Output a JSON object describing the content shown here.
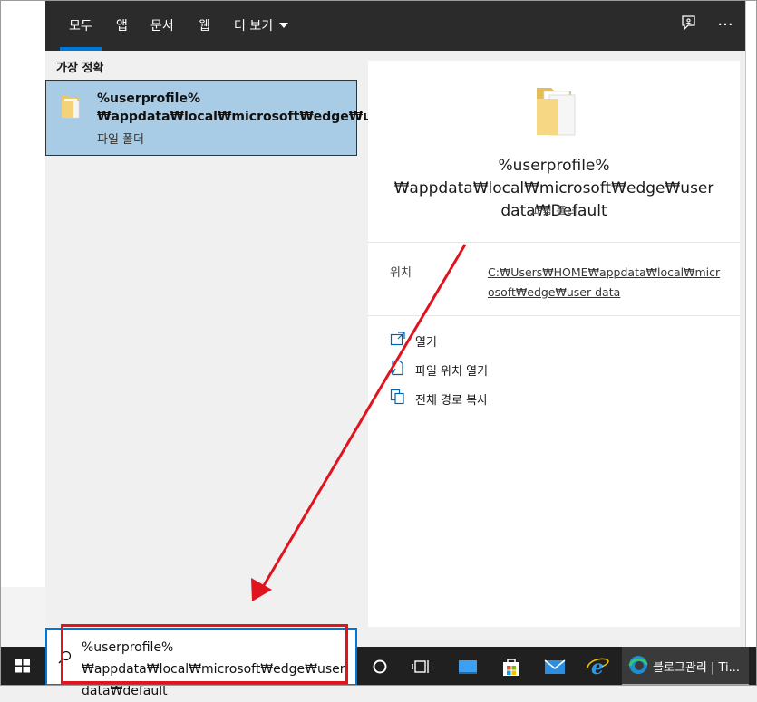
{
  "tabs": [
    {
      "label": "모두",
      "active": true
    },
    {
      "label": "앱"
    },
    {
      "label": "문서"
    },
    {
      "label": "웹"
    },
    {
      "label": "더 보기"
    }
  ],
  "toolbar_icons": [
    "feedback-icon",
    "more-icon"
  ],
  "more_icon_glyph": "···",
  "left_panel": {
    "section_title": "가장 정확",
    "best_match": {
      "title": "%userprofile%₩appdata₩local₩microsoft₩edge₩user",
      "type": "파일 폴더"
    }
  },
  "preview": {
    "title": "%userprofile%₩appdata₩local₩microsoft₩edge₩user data₩Default",
    "type": "파일 폴더",
    "location_label": "위치",
    "location_value": "C:₩Users₩HOME₩appdata₩local₩microsoft₩edge₩user data",
    "actions": [
      {
        "label": "열기",
        "icon": "open-icon"
      },
      {
        "label": "파일 위치 열기",
        "icon": "open-file-location-icon"
      },
      {
        "label": "전체 경로 복사",
        "icon": "copy-path-icon"
      }
    ]
  },
  "search": {
    "query": "%userprofile%₩appdata₩local₩microsoft₩edge₩user data₩default"
  },
  "taskbar": {
    "app_label": "블로그관리 | Ti..."
  },
  "colors": {
    "accent": "#0078d7",
    "selection": "#a9cce6",
    "annotation_red": "#e0141e",
    "topbar": "#2b2b2b",
    "taskbar": "#202020"
  }
}
